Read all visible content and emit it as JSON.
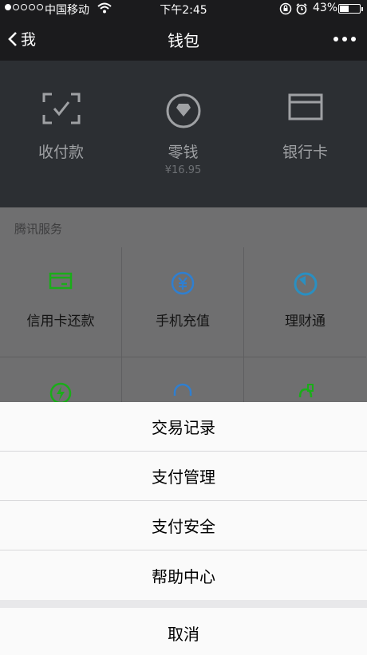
{
  "status_bar": {
    "carrier": "中国移动",
    "time": "下午2:45",
    "battery": "43%"
  },
  "nav": {
    "back_label": "我",
    "title": "钱包"
  },
  "wallet": {
    "items": [
      {
        "label": "收付款",
        "icon": "scan-pay-icon"
      },
      {
        "label": "零钱",
        "sub": "¥16.95",
        "icon": "diamond-icon"
      },
      {
        "label": "银行卡",
        "icon": "bank-card-icon"
      }
    ]
  },
  "services": {
    "title": "腾讯服务",
    "items": [
      {
        "label": "信用卡还款",
        "icon": "credit-card-icon"
      },
      {
        "label": "手机充值",
        "icon": "yen-icon"
      },
      {
        "label": "理财通",
        "icon": "finance-icon"
      },
      {
        "label": "",
        "icon": "lightning-icon"
      },
      {
        "label": "",
        "icon": "headset-icon"
      },
      {
        "label": "",
        "icon": "piggy-icon"
      }
    ]
  },
  "action_sheet": {
    "items": [
      "交易记录",
      "支付管理",
      "支付安全",
      "帮助中心"
    ],
    "cancel": "取消"
  },
  "colors": {
    "accent_green": "#1aad19",
    "accent_blue": "#2f7fd0",
    "accent_teal": "#2a8fc1"
  }
}
